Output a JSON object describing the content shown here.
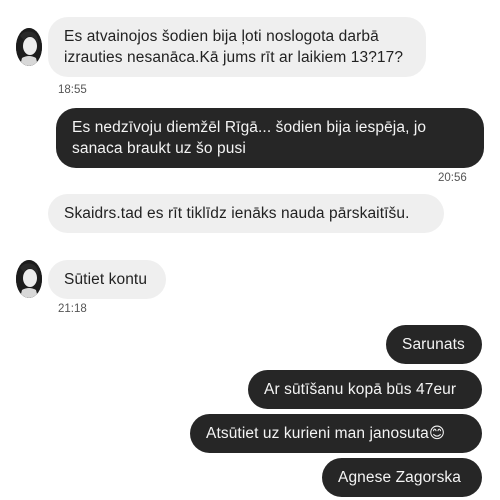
{
  "messages": [
    {
      "text": "Es atvainojos šodien bija ļoti noslogota darbā izrauties nesanāca.Kā jums rīt ar laikiem 13?17?"
    },
    {
      "text": "Es nedzīvoju diemžēl Rīgā... šodien bija iespēja, jo sanaca braukt uz šo pusi"
    },
    {
      "text": "Skaidrs.tad es rīt tiklīdz ienāks nauda pārskaitīšu."
    },
    {
      "text": "Sūtiet kontu"
    },
    {
      "text": "Sarunats"
    },
    {
      "text": "Ar sūtīšanu kopā būs 47eur"
    },
    {
      "text": "Atsūtiet uz kurieni man janosuta😊"
    },
    {
      "text": "Agnese Zagorska"
    }
  ],
  "timestamps": [
    "18:55",
    "20:56",
    "21:18"
  ],
  "colors": {
    "incoming_bg": "#efefef",
    "outgoing_bg": "#262626"
  }
}
